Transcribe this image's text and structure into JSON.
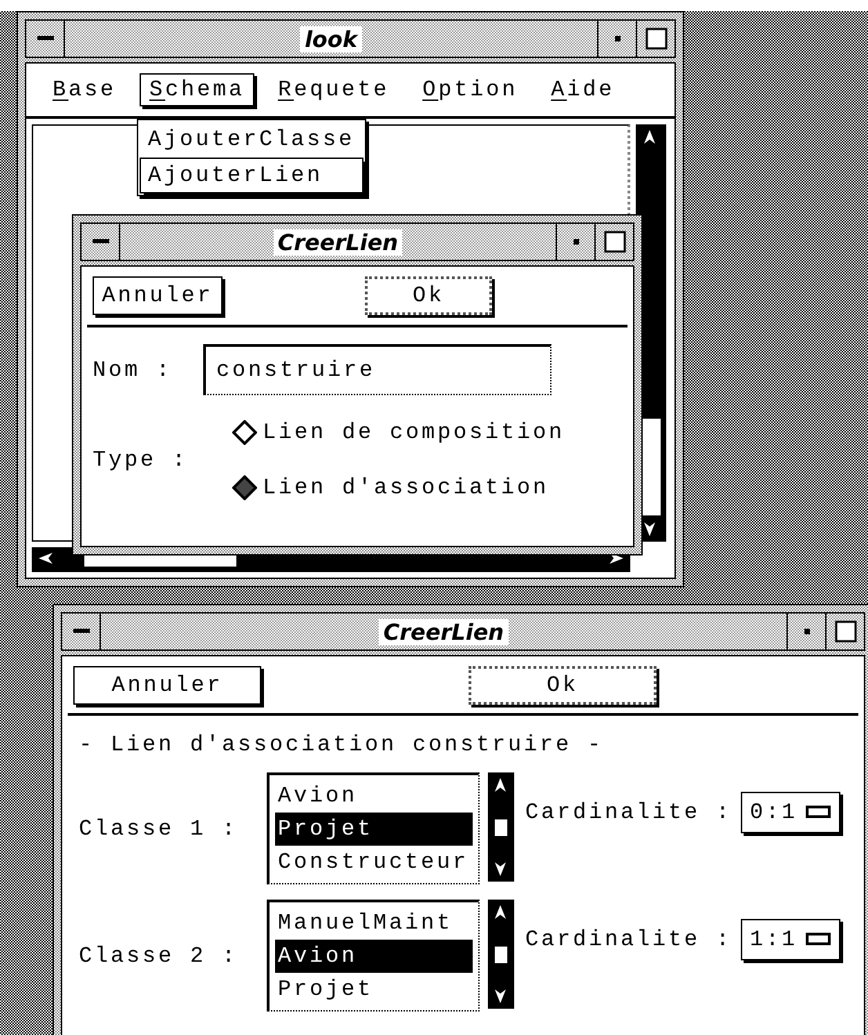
{
  "main_window": {
    "title": "look",
    "menu_bar": [
      {
        "label": "Base",
        "selected": false
      },
      {
        "label": "Schema",
        "selected": true
      },
      {
        "label": "Requete",
        "selected": false
      },
      {
        "label": "Option",
        "selected": false
      },
      {
        "label": "Aide",
        "selected": false
      }
    ],
    "open_menu": [
      {
        "label": "AjouterClasse",
        "selected": false
      },
      {
        "label": "AjouterLien",
        "selected": true
      }
    ]
  },
  "type_dialog": {
    "title": "CreerLien",
    "buttons": [
      {
        "label": "Annuler",
        "default": false
      },
      {
        "label": "Ok",
        "default": true
      }
    ],
    "name_label": "Nom :",
    "name_value": "construire",
    "type_label": "Type :",
    "options": [
      {
        "label": "Lien de composition",
        "selected": false
      },
      {
        "label": "Lien d'association",
        "selected": true
      }
    ]
  },
  "class_dialog": {
    "title": "CreerLien",
    "buttons": [
      {
        "label": "Annuler",
        "default": false
      },
      {
        "label": "Ok",
        "default": true
      }
    ],
    "heading": "- Lien d'association construire -",
    "classes": [
      {
        "label": "Classe 1 :",
        "items": [
          {
            "label": "Avion",
            "selected": false
          },
          {
            "label": "Projet",
            "selected": true
          },
          {
            "label": "Constructeur",
            "selected": false
          }
        ],
        "cardinality_label": "Cardinalite :",
        "cardinality": "0:1"
      },
      {
        "label": "Classe 2 :",
        "items": [
          {
            "label": "ManuelMaint",
            "selected": false
          },
          {
            "label": "Avion",
            "selected": true
          },
          {
            "label": "Projet",
            "selected": false
          }
        ],
        "cardinality_label": "Cardinalite :",
        "cardinality": "1:1"
      }
    ]
  }
}
